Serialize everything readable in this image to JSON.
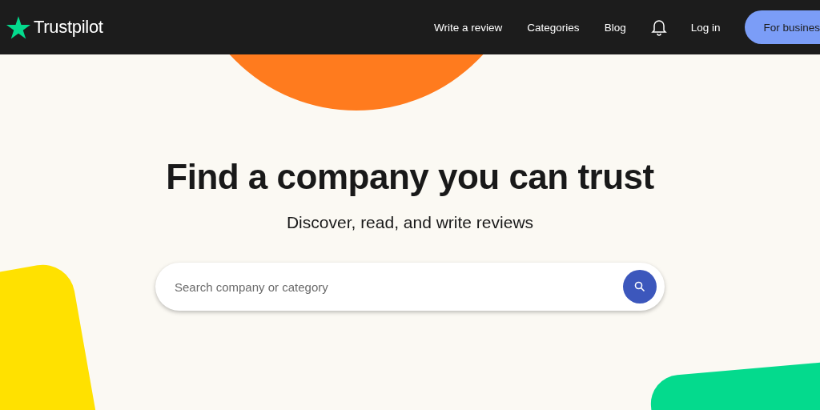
{
  "header": {
    "logo": "Trustpilot",
    "nav": [
      "Write a review",
      "Categories",
      "Blog"
    ],
    "login": "Log in",
    "business_button": "For busines"
  },
  "hero": {
    "title": "Find a company you can trust",
    "subtitle": "Discover, read, and write reviews"
  },
  "search": {
    "placeholder": "Search company or category"
  }
}
